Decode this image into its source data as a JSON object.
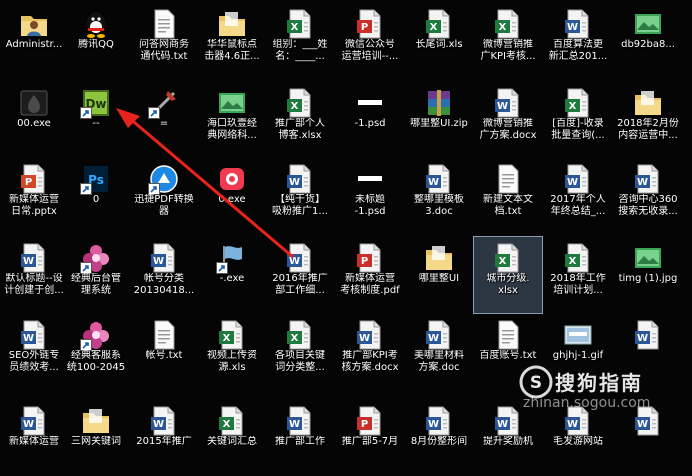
{
  "colors": {
    "word": "#2b5797",
    "excel": "#1f7a3e",
    "pdf": "#c9302c",
    "folder": "#e8c163",
    "blank": "#ffffff"
  },
  "columns": [
    [
      {
        "label": "Administr...",
        "icon": "user-folder-icon"
      },
      {
        "label": "00.exe",
        "icon": "exe-icon"
      },
      {
        "label": "新媒体运营\n日常.pptx",
        "icon": "ppt-icon"
      },
      {
        "label": "默认标题--设\n计创建于创...",
        "icon": "word-icon"
      },
      {
        "label": "SEO外链专\n员绩效考...",
        "icon": "word-icon"
      },
      {
        "label": "新媒体运营",
        "icon": "word-icon"
      }
    ],
    [
      {
        "label": "腾讯QQ",
        "icon": "qq-icon"
      },
      {
        "label": "--",
        "icon": "dreamweaver-icon"
      },
      {
        "label": "0",
        "icon": "photoshop-icon"
      },
      {
        "label": "经典后台管\n理系统",
        "icon": "flower-icon"
      },
      {
        "label": "经典客服系\n统100-2045",
        "icon": "flower-icon"
      },
      {
        "label": "三网关键词",
        "icon": "folder-icon"
      }
    ],
    [
      {
        "label": "问答网商务\n通代码.txt",
        "icon": "txt-icon"
      },
      {
        "label": "=",
        "icon": "tool-icon"
      },
      {
        "label": "迅捷PDF转换\n器",
        "icon": "pdf-converter-icon"
      },
      {
        "label": "帐号分类\n20130418...",
        "icon": "word-icon"
      },
      {
        "label": "帐号.txt",
        "icon": "txt-icon"
      },
      {
        "label": "2015年推广",
        "icon": "word-icon"
      }
    ],
    [
      {
        "label": "华华鼠标点\n击器4.6正...",
        "icon": "folder-icon"
      },
      {
        "label": "海口玖壹经\n典网络科...",
        "icon": "image-icon"
      },
      {
        "label": "0.exe",
        "icon": "camera-icon"
      },
      {
        "label": "-.exe",
        "icon": "flag-icon"
      },
      {
        "label": "视频上传资\n源.xls",
        "icon": "excel-icon"
      },
      {
        "label": "关键词汇总",
        "icon": "excel-icon"
      }
    ],
    [
      {
        "label": "组别：___姓\n名：____...",
        "icon": "excel-icon"
      },
      {
        "label": "推广部个人\n博客.xlsx",
        "icon": "excel-icon"
      },
      {
        "label": "【纯干货】\n吸粉推广1...",
        "icon": "word-icon"
      },
      {
        "label": "2016年推广\n部工作细...",
        "icon": "word-icon"
      },
      {
        "label": "各项目关键\n词分类整...",
        "icon": "excel-icon"
      },
      {
        "label": "推广部工作",
        "icon": "word-icon"
      }
    ],
    [
      {
        "label": "微信公众号\n运营培训--...",
        "icon": "pdf-icon"
      },
      {
        "label": "-1.psd",
        "icon": "blank-icon"
      },
      {
        "label": "未标题\n-1.psd",
        "icon": "blank-icon"
      },
      {
        "label": "新媒体运营\n考核制度.pdf",
        "icon": "pdf-icon"
      },
      {
        "label": "推广部KPI考\n核方案.docx",
        "icon": "word-icon"
      },
      {
        "label": "推广部5-7月",
        "icon": "pdf-icon"
      }
    ],
    [
      {
        "label": "长尾词.xls",
        "icon": "excel-icon"
      },
      {
        "label": "哪里整UI.zip",
        "icon": "winrar-icon"
      },
      {
        "label": "整哪里模板\n3.doc",
        "icon": "word-icon"
      },
      {
        "label": "哪里整UI",
        "icon": "folder-icon"
      },
      {
        "label": "美哪里材料\n方案.doc",
        "icon": "word-icon"
      },
      {
        "label": "8月份整形间",
        "icon": "word-icon"
      }
    ],
    [
      {
        "label": "微博营销推\n广KPI考核...",
        "icon": "excel-icon"
      },
      {
        "label": "微博营销推\n广方案.docx",
        "icon": "word-icon"
      },
      {
        "label": "新建文本文\n档.txt",
        "icon": "txt-icon"
      },
      {
        "label": "城市分级.\nxlsx",
        "icon": "excel-icon",
        "selected": true
      },
      {
        "label": "百度账号.txt",
        "icon": "txt-icon"
      },
      {
        "label": "提升奖励机",
        "icon": "word-icon"
      }
    ],
    [
      {
        "label": "百度算法更\n新汇总201...",
        "icon": "word-icon"
      },
      {
        "label": "[百度]-收录\n批量查询(...",
        "icon": "excel-icon"
      },
      {
        "label": "2017年个人\n年终总结_...",
        "icon": "word-icon"
      },
      {
        "label": "2018年工作\n培训计划...",
        "icon": "excel-icon"
      },
      {
        "label": "ghjhj-1.gif",
        "icon": "gif-icon"
      },
      {
        "label": "毛发游网站",
        "icon": "word-icon"
      }
    ],
    [
      {
        "label": "db92ba8...",
        "icon": "image-icon"
      },
      {
        "label": "2018年2月份\n内容运营中...",
        "icon": "folder-icon"
      },
      {
        "label": "咨询中心360\n搜索无收录...",
        "icon": "word-icon"
      },
      {
        "label": "timg (1).jpg",
        "icon": "image-icon"
      },
      {
        "label": "",
        "icon": "word-icon"
      },
      {
        "label": "",
        "icon": "word-icon"
      }
    ]
  ],
  "watermark": {
    "brand": "搜狗指南",
    "url": "zhinan.sogou.com"
  }
}
